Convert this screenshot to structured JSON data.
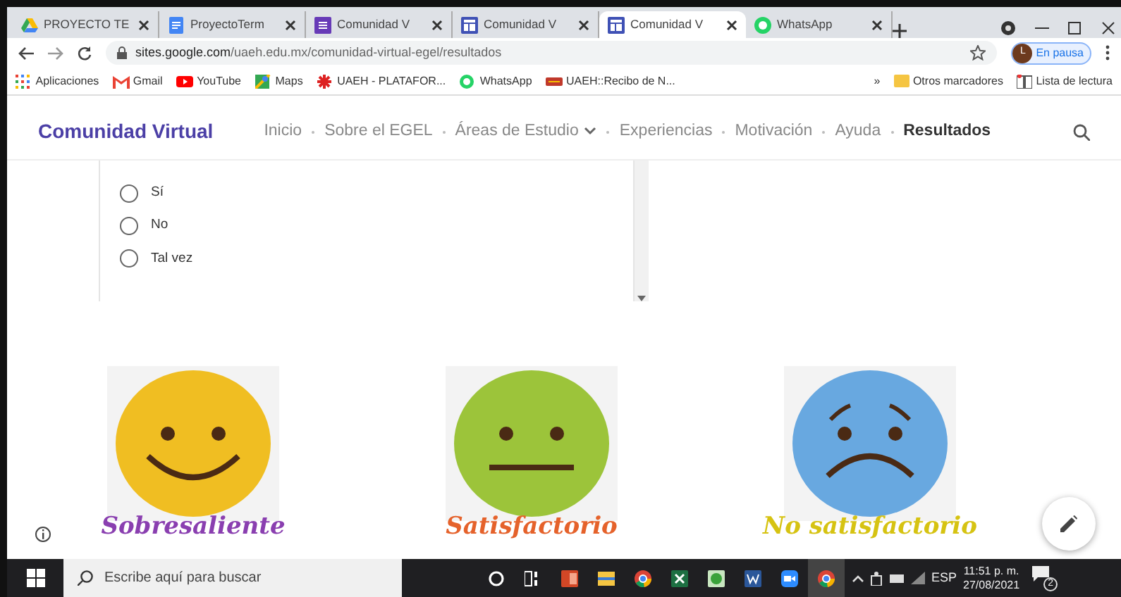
{
  "browser": {
    "tabs": [
      {
        "title": "PROYECTO TE",
        "kind": "drive",
        "selected": false
      },
      {
        "title": "ProyectoTerm",
        "kind": "docs",
        "selected": false
      },
      {
        "title": "Comunidad V",
        "kind": "forms",
        "selected": false
      },
      {
        "title": "Comunidad V",
        "kind": "sites",
        "selected": false
      },
      {
        "title": "Comunidad V",
        "kind": "sites",
        "selected": true
      },
      {
        "title": "WhatsApp",
        "kind": "whatsapp",
        "selected": false
      }
    ],
    "address": {
      "domain": "sites.google.com",
      "path": "/uaeh.edu.mx/comunidad-virtual-egel/resultados"
    },
    "profile": {
      "initial": "L",
      "label": "En pausa"
    },
    "bookmarks": [
      {
        "label": "Aplicaciones",
        "kind": "apps"
      },
      {
        "label": "Gmail",
        "kind": "gmail"
      },
      {
        "label": "YouTube",
        "kind": "youtube"
      },
      {
        "label": "Maps",
        "kind": "maps"
      },
      {
        "label": "UAEH - PLATAFOR...",
        "kind": "uaeh"
      },
      {
        "label": "WhatsApp",
        "kind": "whatsapp"
      },
      {
        "label": "UAEH::Recibo de N...",
        "kind": "recibo"
      }
    ],
    "more": "»",
    "other_bookmarks": "Otros marcadores",
    "reading_list": "Lista de lectura"
  },
  "site": {
    "title": "Comunidad Virtual",
    "nav": [
      {
        "label": "Inicio",
        "selected": false,
        "dropdown": false
      },
      {
        "label": "Sobre el EGEL",
        "selected": false,
        "dropdown": false
      },
      {
        "label": "Áreas de Estudio",
        "selected": false,
        "dropdown": true
      },
      {
        "label": "Experiencias",
        "selected": false,
        "dropdown": false
      },
      {
        "label": "Motivación",
        "selected": false,
        "dropdown": false
      },
      {
        "label": "Ayuda",
        "selected": false,
        "dropdown": false
      },
      {
        "label": "Resultados",
        "selected": true,
        "dropdown": false
      }
    ]
  },
  "form": {
    "options": [
      {
        "label": "Sí",
        "selected": false
      },
      {
        "label": "No",
        "selected": false
      },
      {
        "label": "Tal vez",
        "selected": false
      }
    ]
  },
  "ratings": [
    {
      "face": {
        "kind": "happy",
        "color": "#f0be22"
      },
      "label": {
        "text": "Sobresaliente",
        "color": "#8a3fb0"
      }
    },
    {
      "face": {
        "kind": "neutral",
        "color": "#9cc43a"
      },
      "label": {
        "text": "Satisfactorio",
        "color": "#e5622b"
      }
    },
    {
      "face": {
        "kind": "sad",
        "color": "#68a8e0"
      },
      "label": {
        "text": "No satisfactorio",
        "color": "#d6c312"
      }
    }
  ],
  "taskbar": {
    "search_placeholder": "Escribe aquí para buscar",
    "apps": [
      {
        "kind": "cortana"
      },
      {
        "kind": "taskview"
      },
      {
        "kind": "powerpoint"
      },
      {
        "kind": "explorer"
      },
      {
        "kind": "chrome"
      },
      {
        "kind": "excel"
      },
      {
        "kind": "green"
      },
      {
        "kind": "word"
      },
      {
        "kind": "zoom"
      },
      {
        "kind": "chrome-active"
      }
    ],
    "language": "ESP",
    "time": "11:51 p. m.",
    "date": "27/08/2021",
    "notifications": "2"
  }
}
